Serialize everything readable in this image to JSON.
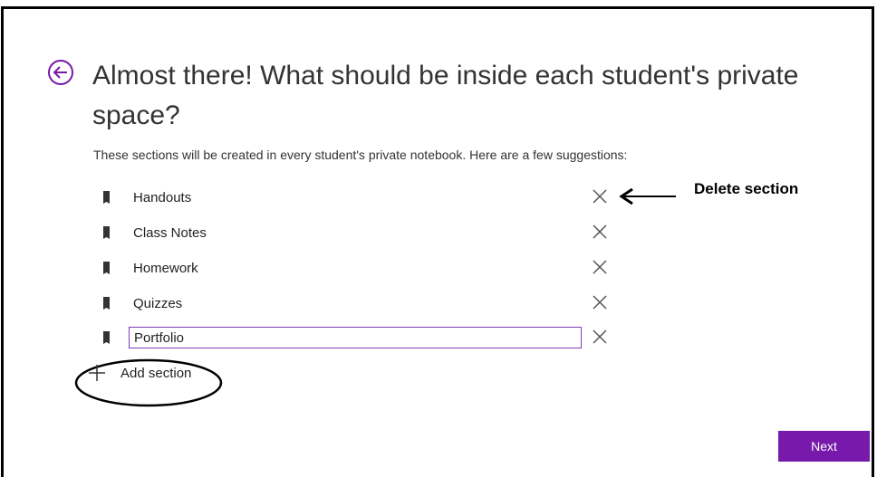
{
  "dialog": {
    "title": "Almost there! What should be inside each student's private space?",
    "subtitle": "These sections will be created in every student's private notebook. Here are a few suggestions:",
    "sections": [
      {
        "label": "Handouts"
      },
      {
        "label": "Class Notes"
      },
      {
        "label": "Homework"
      },
      {
        "label": "Quizzes"
      }
    ],
    "editing_section_value": "Portfolio",
    "add_section_label": "Add section",
    "next_label": "Next"
  },
  "annotations": {
    "delete_hint": "Delete section"
  },
  "colors": {
    "accent": "#7719aa",
    "input_border": "#7e3bb6",
    "text": "#333333"
  },
  "icons": [
    "back-arrow-icon",
    "section-tab-icon",
    "close-icon",
    "plus-icon"
  ]
}
